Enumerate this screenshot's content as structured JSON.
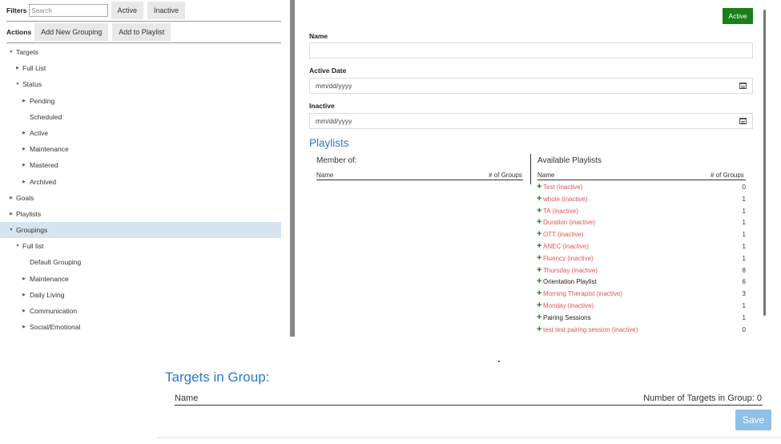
{
  "filters": {
    "label": "Filters",
    "search_placeholder": "Search",
    "search_value": "",
    "active_btn": "Active",
    "inactive_btn": "Inactive"
  },
  "actions": {
    "label": "Actions",
    "add_grouping": "Add New Grouping",
    "add_playlist": "Add to Playlist"
  },
  "tree": [
    {
      "label": "Targets",
      "expanded": true
    },
    {
      "label": "Full List",
      "expanded": false
    },
    {
      "label": "Status",
      "expanded": true
    },
    {
      "label": "Pending",
      "expanded": false
    },
    {
      "label": "Scheduled"
    },
    {
      "label": "Active",
      "expanded": false
    },
    {
      "label": "Maintenance",
      "expanded": false
    },
    {
      "label": "Mastered",
      "expanded": false
    },
    {
      "label": "Archived",
      "expanded": false
    },
    {
      "label": "Goals",
      "expanded": false
    },
    {
      "label": "Playlists",
      "expanded": false
    },
    {
      "label": "Groupings",
      "expanded": true,
      "selected": true
    },
    {
      "label": "Full list",
      "expanded": true
    },
    {
      "label": "Default Grouping"
    },
    {
      "label": "Maintenance",
      "expanded": false
    },
    {
      "label": "Daily Living",
      "expanded": false
    },
    {
      "label": "Communication",
      "expanded": false
    },
    {
      "label": "Social/Emotional",
      "expanded": false
    }
  ],
  "form": {
    "status_badge": "Active",
    "name_label": "Name",
    "name_value": "",
    "active_date_label": "Active Date",
    "active_date_value": "mm/dd/yyyy",
    "inactive_label": "Inactive",
    "inactive_value": "mm/dd/yyyy"
  },
  "playlists": {
    "title": "Playlists",
    "member_of": {
      "title": "Member of:",
      "col_name": "Name",
      "col_groups": "# of Groups"
    },
    "available": {
      "title": "Available Playlists",
      "col_name": "Name",
      "col_groups": "# of Groups",
      "items": [
        {
          "name": "Test (inactive)",
          "count": "0",
          "inactive": true
        },
        {
          "name": "whole (inactive)",
          "count": "1",
          "inactive": true
        },
        {
          "name": "TA (inactive)",
          "count": "1",
          "inactive": true
        },
        {
          "name": "Duration (inactive)",
          "count": "1",
          "inactive": true
        },
        {
          "name": "OTT (inactive)",
          "count": "1",
          "inactive": true
        },
        {
          "name": "ANEC (inactive)",
          "count": "1",
          "inactive": true
        },
        {
          "name": "Fluency (inactive)",
          "count": "1",
          "inactive": true
        },
        {
          "name": "Thursday (inactive)",
          "count": "8",
          "inactive": true
        },
        {
          "name": "Orientation Playlist",
          "count": "6",
          "inactive": false
        },
        {
          "name": "Morning Therapist (inactive)",
          "count": "3",
          "inactive": true
        },
        {
          "name": "Monday (inactive)",
          "count": "1",
          "inactive": true
        },
        {
          "name": "Pairing Sessions",
          "count": "1",
          "inactive": false
        },
        {
          "name": "test test pairing session (inactive)",
          "count": "0",
          "inactive": true
        }
      ]
    }
  },
  "targets_in_group": {
    "title": "Targets in Group:",
    "col_name": "Name",
    "count_label": "Number of Targets in Group: 0"
  },
  "save_label": "Save",
  "colors": {
    "accent_blue": "#2a7ac7",
    "active_green": "#1a7f1a",
    "inactive_red": "#e05555",
    "selected_bg": "#d6e4f0",
    "save_disabled": "#8ec0e8"
  }
}
